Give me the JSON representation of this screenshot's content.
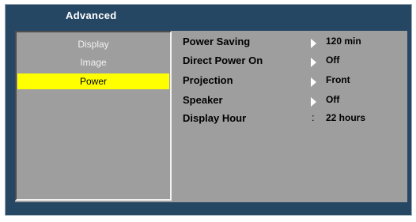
{
  "title": "Advanced",
  "sidebar": {
    "items": [
      {
        "label": "Display"
      },
      {
        "label": "Image"
      },
      {
        "label": "Power"
      }
    ]
  },
  "settings": [
    {
      "label": "Power Saving",
      "value": "120 min",
      "indicator": "arrow-right-icon"
    },
    {
      "label": "Direct Power On",
      "value": "Off",
      "indicator": "arrow-right-icon"
    },
    {
      "label": "Projection",
      "value": "Front",
      "indicator": "arrow-right-icon"
    },
    {
      "label": "Speaker",
      "value": "Off",
      "indicator": "arrow-right-icon"
    },
    {
      "label": "Display Hour",
      "value": "22 hours",
      "separator": ":"
    }
  ],
  "colors": {
    "frame": "#254764",
    "content": "#9e9e9e",
    "selected": "#ffff00"
  }
}
